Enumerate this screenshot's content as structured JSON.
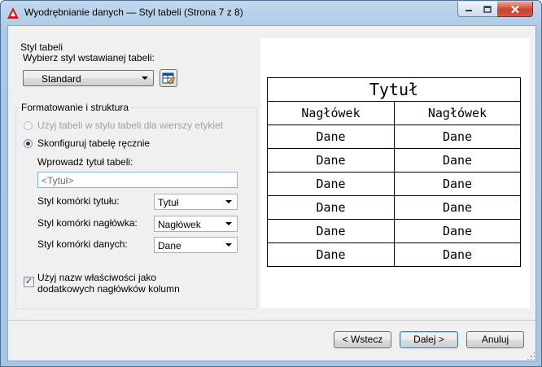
{
  "window": {
    "title": "Wyodrębnianie danych — Styl tabeli (Strona 7 z 8)"
  },
  "icons": {
    "app": "autocad-a-icon",
    "table_style_edit": "table-style-edit-icon",
    "minimize": "minimize-icon",
    "maximize": "maximize-icon",
    "close": "close-icon"
  },
  "table_style": {
    "group_title": "Styl tabeli",
    "select_label": "Wybierz styl wstawianej tabeli:",
    "selected": "Standard"
  },
  "formatting": {
    "group_title": "Formatowanie i struktura",
    "option_use_table": "Użyj tabeli w stylu tabeli dla wierszy etykiet",
    "option_manual": "Skonfiguruj tabelę ręcznie",
    "title_label": "Wprowadź tytuł tabeli:",
    "title_value": "<Tytuł>",
    "title_cell_label": "Styl komórki tytułu:",
    "title_cell_value": "Tytuł",
    "header_cell_label": "Styl komórki nagłówka:",
    "header_cell_value": "Nagłówek",
    "data_cell_label": "Styl komórki danych:",
    "data_cell_value": "Dane",
    "checkbox_line1": "Użyj nazw właściwości jako",
    "checkbox_line2": "dodatkowych nagłówków kolumn",
    "checkbox_checked": true
  },
  "preview": {
    "title": "Tytuł",
    "headers": [
      "Nagłówek",
      "Nagłówek"
    ],
    "rows": [
      [
        "Dane",
        "Dane"
      ],
      [
        "Dane",
        "Dane"
      ],
      [
        "Dane",
        "Dane"
      ],
      [
        "Dane",
        "Dane"
      ],
      [
        "Dane",
        "Dane"
      ],
      [
        "Dane",
        "Dane"
      ]
    ]
  },
  "buttons": {
    "back": "< Wstecz",
    "next": "Dalej >",
    "cancel": "Anuluj"
  }
}
